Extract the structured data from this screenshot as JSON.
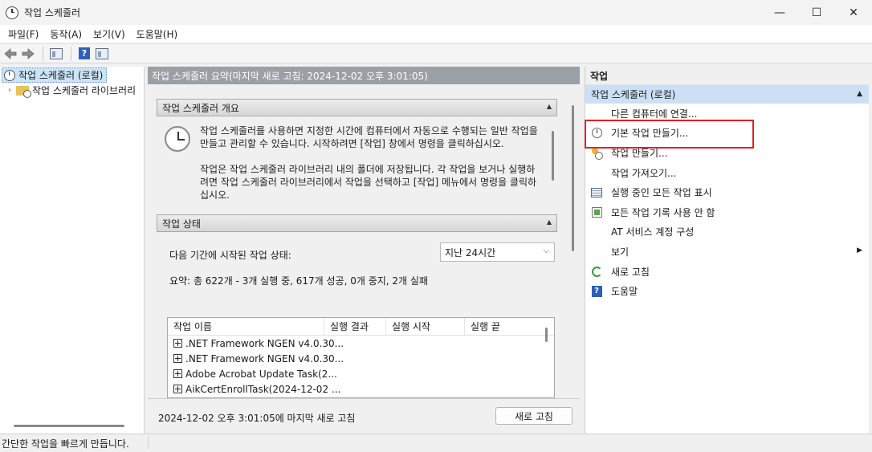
{
  "window": {
    "title": "작업 스케줄러",
    "minimize_glyph": "—",
    "maximize_glyph": "☐",
    "close_glyph": "✕"
  },
  "menu": [
    "파일(F)",
    "동작(A)",
    "보기(V)",
    "도움말(H)"
  ],
  "toolbar": {
    "back_icon": "back-arrow-icon",
    "forward_icon": "forward-arrow-icon",
    "help_glyph": "?"
  },
  "tree": {
    "root_label": "작업 스케줄러 (로컬)",
    "child_label": "작업 스케줄러 라이브러리",
    "expander_glyph": "›"
  },
  "middle": {
    "header": "작업 스케줄러 요약(마지막 새로 고침: 2024-12-02 오후 3:01:05)",
    "overview": {
      "title": "작업 스케줄러 개요",
      "paragraph1": "작업 스케줄러를 사용하면 지정한 시간에 컴퓨터에서 자동으로 수행되는 일반 작업을 만들고 관리할 수 있습니다. 시작하려면 [작업] 창에서 명령을 클릭하십시오.",
      "paragraph2": "작업은 작업 스케줄러 라이브러리 내의 폴더에 저장됩니다. 각 작업을 보거나 실행하려면 작업 스케줄러 라이브러리에서 작업을 선택하고 [작업] 메뉴에서 명령을 클릭하십시오."
    },
    "status": {
      "title": "작업 상태",
      "period_label": "다음 기간에 시작된 작업 상태:",
      "period_value": "지난 24시간",
      "summary": "요약: 총 622개 - 3개 실행 중, 617개 성공, 0개 중지, 2개 실패",
      "columns": [
        "작업 이름",
        "실행 결과",
        "실행 시작",
        "실행 끝"
      ],
      "rows": [
        ".NET Framework NGEN v4.0.30...",
        ".NET Framework NGEN v4.0.30...",
        "Adobe Acrobat Update Task(2...",
        "AikCertEnrollTask(2024-12-02 ..."
      ]
    },
    "footer": {
      "last_refresh": "2024-12-02 오후 3:01:05에 마지막 새로 고침",
      "refresh_button": "새로 고침"
    }
  },
  "actions": {
    "title": "작업",
    "section": "작업 스케줄러 (로컬)",
    "items": [
      {
        "label": "다른 컴퓨터에 연결...",
        "icon": ""
      },
      {
        "label": "기본 작업 만들기...",
        "icon": "create-basic-task-icon"
      },
      {
        "label": "작업 만들기...",
        "icon": "create-task-icon"
      },
      {
        "label": "작업 가져오기...",
        "icon": ""
      },
      {
        "label": "실행 중인 모든 작업 표시",
        "icon": "running-tasks-icon"
      },
      {
        "label": "모든 작업 기록 사용 안 함",
        "icon": "task-history-icon"
      },
      {
        "label": "AT 서비스 계정 구성",
        "icon": ""
      },
      {
        "label": "보기",
        "icon": ""
      },
      {
        "label": "새로 고침",
        "icon": "refresh-icon"
      },
      {
        "label": "도움말",
        "icon": "help-icon"
      }
    ],
    "highlight_color": "#e0202a"
  },
  "statusbar": {
    "text": "간단한 작업을 빠르게 만듭니다."
  }
}
